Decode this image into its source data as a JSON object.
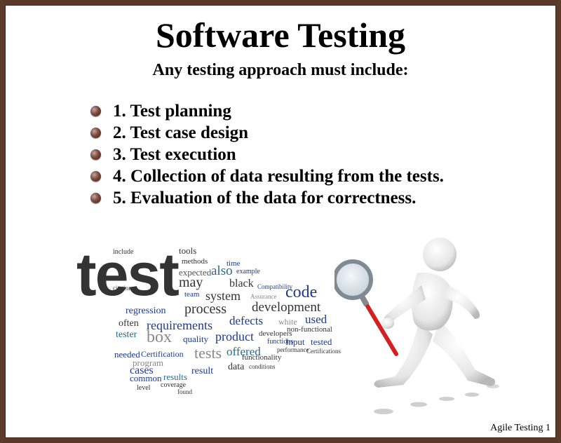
{
  "slide": {
    "title": "Software Testing",
    "subtitle": "Any testing approach must include:",
    "bullets": [
      "1. Test planning",
      "2. Test case design",
      "3. Test execution",
      "4. Collection of data resulting from the tests.",
      "5. Evaluation of the data for correctness."
    ],
    "footer": "Agile Testing 1"
  },
  "word_cloud": {
    "words": [
      "test",
      "tools",
      "methods",
      "time",
      "also",
      "example",
      "expected",
      "may",
      "black",
      "code",
      "system",
      "team",
      "development",
      "process",
      "defects",
      "used",
      "requirements",
      "often",
      "regression",
      "tester",
      "box",
      "quality",
      "product",
      "developers",
      "non-functional",
      "Input",
      "tested",
      "tests",
      "offered",
      "needed",
      "Certification",
      "cases",
      "program",
      "result",
      "data",
      "functionality",
      "common",
      "results",
      "coverage",
      "level",
      "found",
      "include",
      "citation",
      "defect",
      "white",
      "functions",
      "conditions",
      "Compatibility",
      "Assurance",
      "performance",
      "Certifications"
    ]
  },
  "colors": {
    "background": "#5b3a2c",
    "slide": "#ffffff",
    "cloud_dark": "#333333",
    "cloud_blue": "#1f3a8a",
    "cloud_teal": "#2a6a8a",
    "magnifier_handle": "#d42020"
  },
  "icons": {
    "bullet": "round-bullet-icon",
    "figure": "magnifying-glass-figure-icon"
  }
}
